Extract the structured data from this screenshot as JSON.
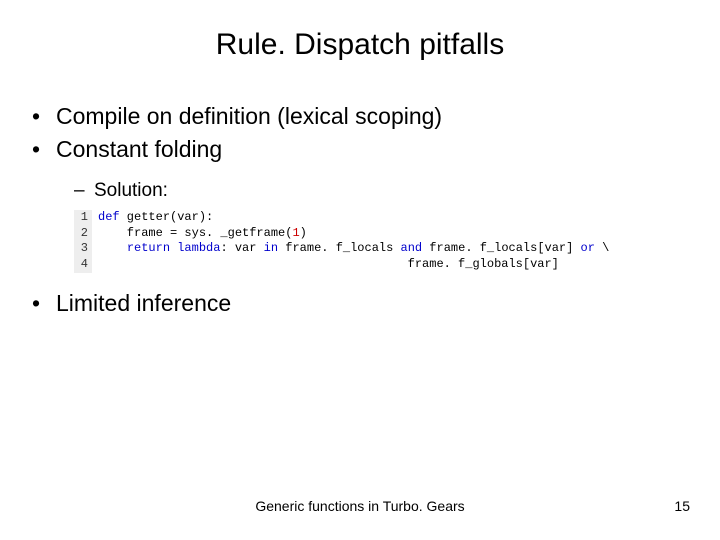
{
  "title": "Rule. Dispatch pitfalls",
  "bullets": {
    "b1": "Compile on definition (lexical scoping)",
    "b2": "Constant folding",
    "sub1": "Solution:",
    "b3": "Limited inference"
  },
  "code": {
    "ln1": "1",
    "ln2": "2",
    "ln3": "3",
    "ln4": "4",
    "kw_def": "def",
    "l1_rest": " getter(var):",
    "l2_a": "    frame = sys. _getframe(",
    "l2_num": "1",
    "l2_b": ")",
    "kw_return": "return",
    "kw_lambda": "lambda",
    "l3_a": ": var ",
    "kw_in": "in",
    "l3_b": " frame. f_locals ",
    "kw_and": "and",
    "l3_c": " frame. f_locals[var] ",
    "kw_or": "or",
    "l3_d": " \\",
    "l4": "                                           frame. f_globals[var]"
  },
  "footer": {
    "caption": "Generic functions in Turbo. Gears",
    "page": "15"
  }
}
